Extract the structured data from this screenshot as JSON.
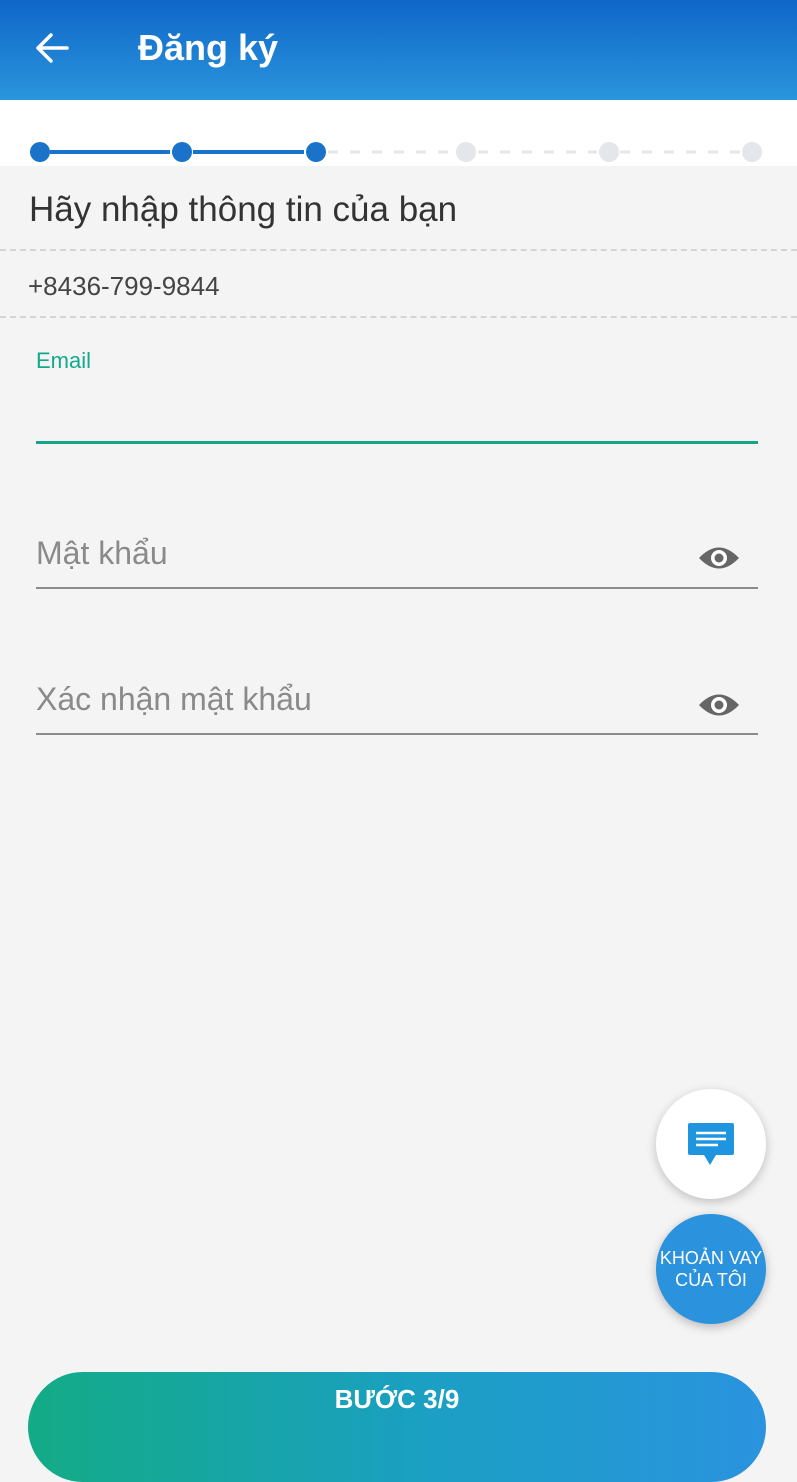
{
  "header": {
    "back_icon": "arrow-left-icon",
    "title": "Đăng ký"
  },
  "stepper": {
    "total_steps": 6,
    "completed_steps": 3,
    "active_color": "#1a73c9",
    "inactive_color": "#e3e6ea"
  },
  "form": {
    "title": "Hãy nhập thông tin của bạn",
    "phone": "+8436-799-9844",
    "email": {
      "label": "Email",
      "value": ""
    },
    "password": {
      "placeholder": "Mật khẩu",
      "toggle_icon": "eye-icon"
    },
    "confirm_password": {
      "placeholder": "Xác nhận mật khẩu",
      "toggle_icon": "eye-icon"
    }
  },
  "fabs": {
    "chat_icon": "chat-message-icon",
    "loans_line1": "KHOẢN VAY",
    "loans_line2": "CỦA TÔI"
  },
  "footer": {
    "step_label": "BƯỚC 3/9"
  },
  "colors": {
    "header_gradient_top": "#0f66c8",
    "header_gradient_bottom": "#2a95dc",
    "accent_green": "#17a386",
    "fab_blue": "#2b92dd"
  }
}
